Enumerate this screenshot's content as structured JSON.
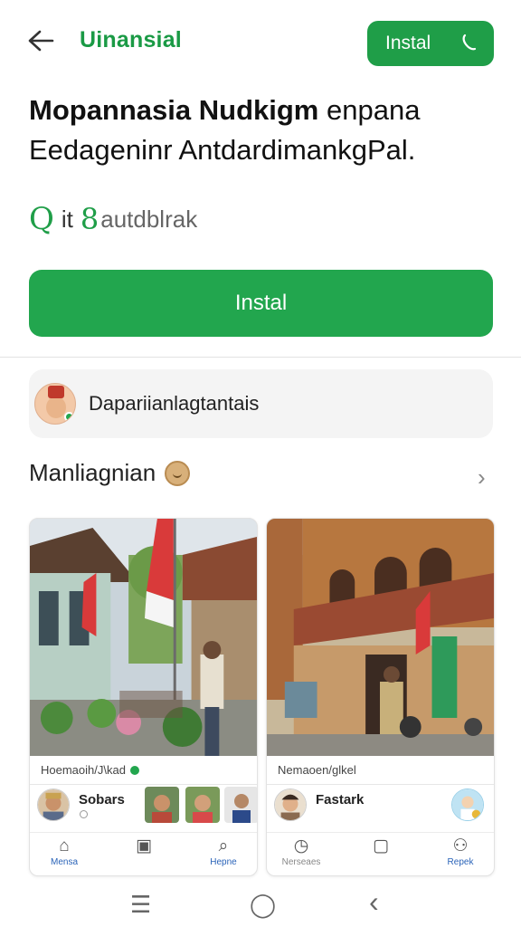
{
  "header": {
    "back_icon": "arrow-left-icon",
    "title": "Uinansial",
    "install_label": "Instal",
    "install_icon": "phone-icon"
  },
  "headline": {
    "bold": "Mopannasia Nudkigm",
    "rest_line1": " enpana",
    "line2": "Eedageninr AntdardimankgPal."
  },
  "rating": {
    "q": "Q",
    "it": "it",
    "num": "8",
    "text": "autdblrak"
  },
  "install_button": "Instal",
  "developer": {
    "name": "Dapariianlagtantais",
    "avatar_icon": "avatar-icon"
  },
  "section": {
    "title": "Manliagnian",
    "chevron": "›"
  },
  "screenshots": [
    {
      "caption": "Hoemaoih/J\\kad",
      "user_name": "Sobars",
      "nav": [
        {
          "icon": "home-icon",
          "glyph": "⌂",
          "label": "Mensa"
        },
        {
          "icon": "image-icon",
          "glyph": "▣",
          "label": ""
        },
        {
          "icon": "search-icon",
          "glyph": "⌕",
          "label": "Hepne"
        }
      ]
    },
    {
      "caption": "Nemaoen/glkel",
      "user_name": "Fastark",
      "nav": [
        {
          "icon": "clock-icon",
          "glyph": "◷",
          "label": "Nerseaes"
        },
        {
          "icon": "clipboard-icon",
          "glyph": "▢",
          "label": ""
        },
        {
          "icon": "person-icon",
          "glyph": "⚇",
          "label": "Repek"
        }
      ]
    }
  ],
  "system_nav": {
    "recents": "☰",
    "home": "◯",
    "back": "‹"
  },
  "colors": {
    "brand_green": "#1f9e48",
    "install_green": "#22a64e",
    "nav_blue": "#2a63b8"
  }
}
